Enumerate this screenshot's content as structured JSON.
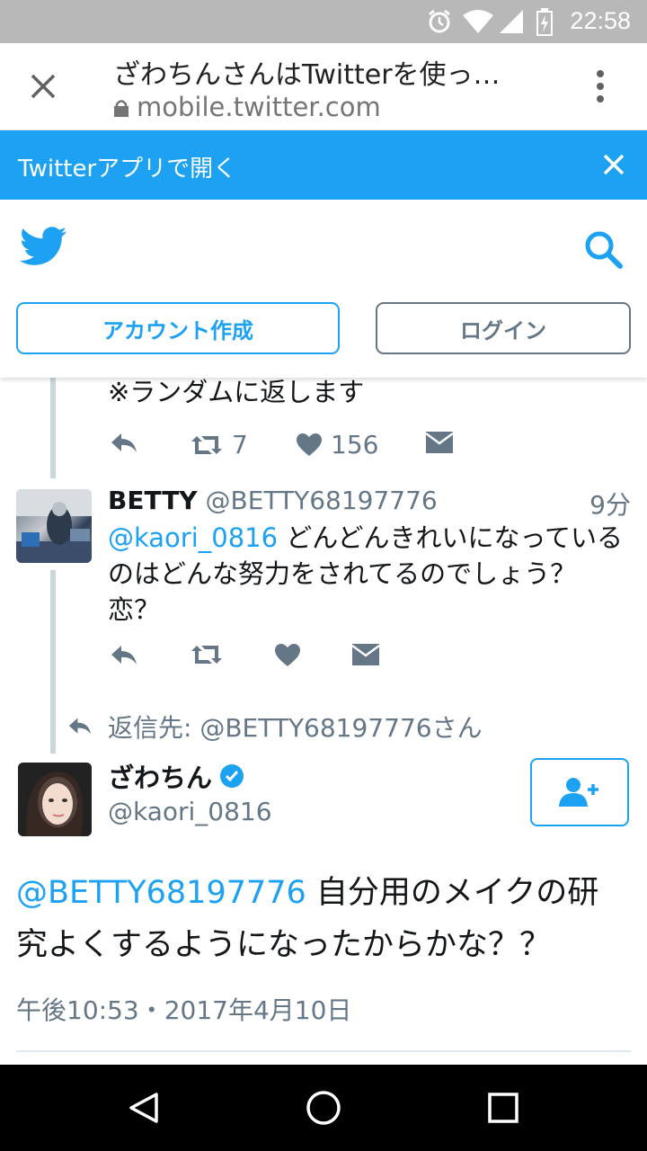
{
  "status_bar": {
    "time": "22:58"
  },
  "browser": {
    "title": "ざわちんさんはTwitterを使っ…",
    "url": "mobile.twitter.com"
  },
  "app_banner": {
    "text": "Twitterアプリで開く"
  },
  "header": {
    "signup_label": "アカウント作成",
    "login_label": "ログイン"
  },
  "tweet1": {
    "text_tail": "※ランダムに返します",
    "retweets": "7",
    "likes": "156"
  },
  "tweet2": {
    "name": "BETTY",
    "handle": "@BETTY68197776",
    "time": "9分",
    "mention": "@kaori_0816",
    "text_line1": " どんどんきれいになっている",
    "text_line2": "のはどんな努力をされてるのでしょう？",
    "text_line3": "恋？"
  },
  "reply_context": {
    "text": "返信先: @BETTY68197776さん"
  },
  "main_tweet": {
    "name": "ざわちん",
    "handle": "@kaori_0816",
    "mention": "@BETTY68197776",
    "text_line1": " 自分用のメイクの研",
    "text_line2": "究よくするようになったからかな？？",
    "timestamp": "午後10:53・2017年4月10日"
  },
  "colors": {
    "accent": "#1da1f2",
    "muted": "#657786",
    "thread_line": "#ccd6dd"
  }
}
